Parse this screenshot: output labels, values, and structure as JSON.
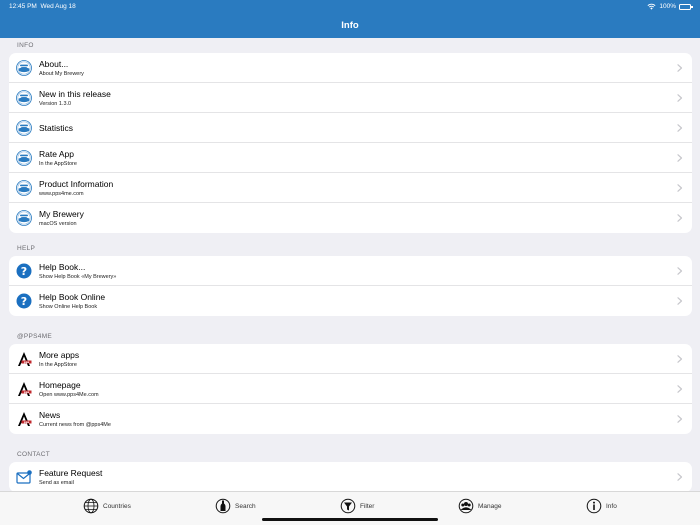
{
  "status": {
    "time": "12:45 PM",
    "date": "Wed Aug 18",
    "battery": "100%"
  },
  "header": {
    "title": "Info"
  },
  "sections": {
    "info": {
      "label": "INFO",
      "items": [
        {
          "title": "About...",
          "subtitle": "About My Brewery"
        },
        {
          "title": "New in this release",
          "subtitle": "Version 1.3.0"
        },
        {
          "title": "Statistics",
          "subtitle": ""
        },
        {
          "title": "Rate App",
          "subtitle": "In the AppStore"
        },
        {
          "title": "Product Information",
          "subtitle": "www.pps4me.com"
        },
        {
          "title": "My Brewery",
          "subtitle": "macOS version"
        }
      ]
    },
    "help": {
      "label": "HELP",
      "items": [
        {
          "title": "Help Book...",
          "subtitle": "Show Help Book «My Brewery»"
        },
        {
          "title": "Help Book Online",
          "subtitle": "Show Online Help Book"
        }
      ]
    },
    "pps4me": {
      "label": "@PPS4ME",
      "items": [
        {
          "title": "More apps",
          "subtitle": "In the AppStore"
        },
        {
          "title": "Homepage",
          "subtitle": "Open www.pps4Me.com"
        },
        {
          "title": "News",
          "subtitle": "Current news from @pps4Me"
        }
      ]
    },
    "contact": {
      "label": "CONTACT",
      "items": [
        {
          "title": "Feature Request",
          "subtitle": "Send as email"
        }
      ]
    }
  },
  "tabs": [
    {
      "label": "Countries",
      "icon": "globe-icon"
    },
    {
      "label": "Search",
      "icon": "bottle-icon"
    },
    {
      "label": "Filter",
      "icon": "filter-icon"
    },
    {
      "label": "Manage",
      "icon": "crowd-icon"
    },
    {
      "label": "Info",
      "icon": "info-icon",
      "active": true
    }
  ],
  "colors": {
    "header": "#2a7bc0",
    "help_icon": "#1a6fc0",
    "background": "#efeff4"
  }
}
